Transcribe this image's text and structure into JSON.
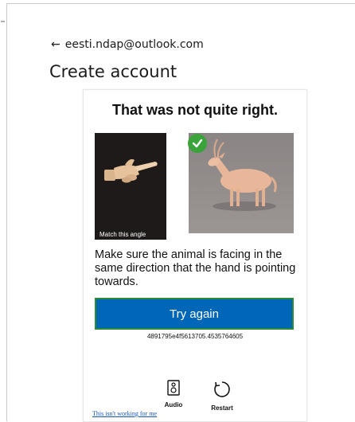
{
  "header": {
    "back_arrow": "←",
    "email": "eesti.ndap@outlook.com",
    "title": "Create account"
  },
  "challenge": {
    "heading": "That was not quite right.",
    "left_image_label": "Match this angle",
    "instruction": "Make sure the animal is facing in the same direction that the hand is pointing towards.",
    "button_label": "Try again",
    "code": "4891795e4f5613705.4535764605",
    "audio_label": "Audio",
    "restart_label": "Restart",
    "left_image_icon": "pointing-hand",
    "right_image_icon": "antelope",
    "selected_icon": "checkmark",
    "colors": {
      "button": "#0067b8",
      "button_border": "#2a8a3a",
      "check": "#3aa33a"
    }
  },
  "footer": {
    "not_working_link": "This isn't working for me"
  }
}
